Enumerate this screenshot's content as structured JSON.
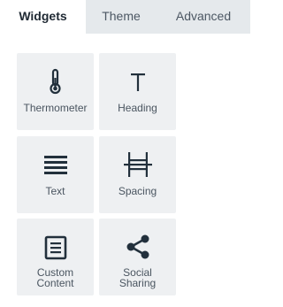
{
  "tabs": [
    {
      "label": "Widgets",
      "active": true
    },
    {
      "label": "Theme",
      "active": false
    },
    {
      "label": "Advanced",
      "active": false
    }
  ],
  "widgets": [
    {
      "label": "Thermometer",
      "icon": "thermometer-icon"
    },
    {
      "label": "Heading",
      "icon": "heading-icon"
    },
    {
      "label": "Text",
      "icon": "text-lines-icon"
    },
    {
      "label": "Spacing",
      "icon": "spacing-icon"
    },
    {
      "label_line1": "Custom",
      "label_line2": "Content",
      "icon": "custom-content-icon"
    },
    {
      "label_line1": "Social",
      "label_line2": "Sharing",
      "icon": "share-icon"
    }
  ],
  "colors": {
    "tab_bar": "#e5e9ec",
    "tile_background": "#eef0f2",
    "icon": "#22303c"
  }
}
